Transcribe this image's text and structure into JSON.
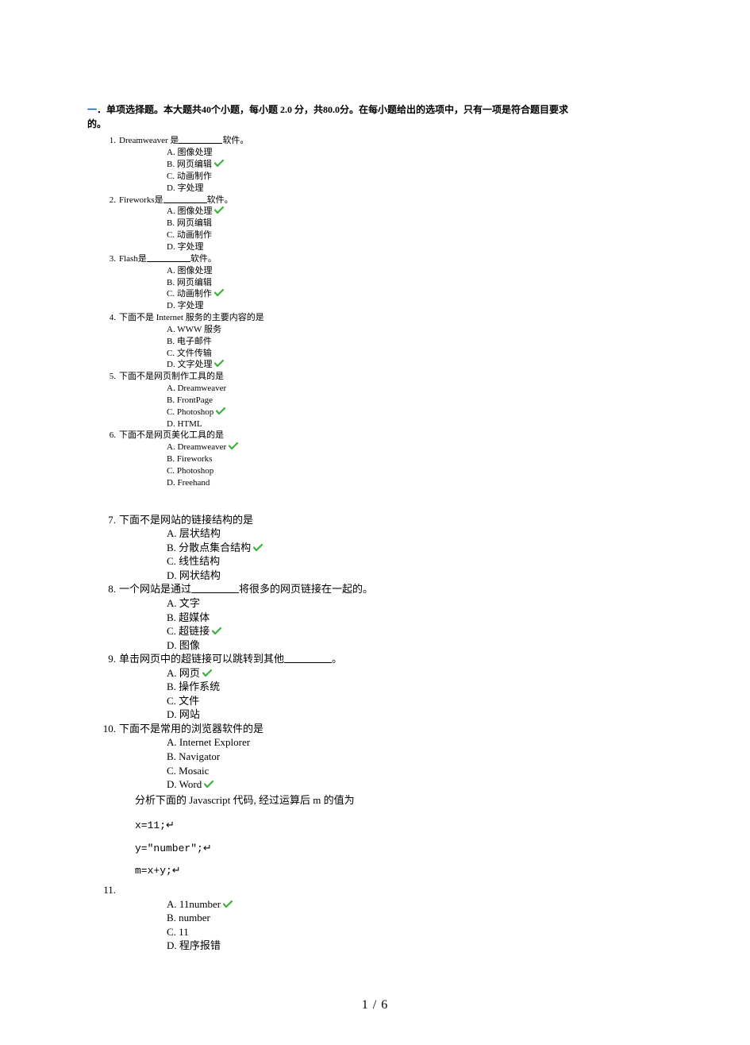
{
  "header": {
    "section_num": "一",
    "section_label": "．单项选择题。",
    "section_body_a": "本大题共40个小题，每小题 2.0 分，共80.0分。在每小题给出的选项中，只有一项是符合题目要求",
    "section_body_b": "的。"
  },
  "questions_small": [
    {
      "num": "1.",
      "stem_before": "Dreamweaver 是",
      "blank": true,
      "stem_after": "软件。",
      "options": [
        {
          "letter": "A.",
          "text": "图像处理",
          "correct": false
        },
        {
          "letter": "B.",
          "text": "网页编辑",
          "correct": true
        },
        {
          "letter": "C.",
          "text": "动画制作",
          "correct": false
        },
        {
          "letter": "D.",
          "text": "字处理",
          "correct": false
        }
      ]
    },
    {
      "num": "2.",
      "stem_before": "Fireworks是",
      "blank": true,
      "stem_after": "软件。",
      "options": [
        {
          "letter": "A.",
          "text": "图像处理",
          "correct": true
        },
        {
          "letter": "B.",
          "text": "网页编辑",
          "correct": false
        },
        {
          "letter": "C.",
          "text": "动画制作",
          "correct": false
        },
        {
          "letter": "D.",
          "text": "字处理",
          "correct": false
        }
      ]
    },
    {
      "num": "3.",
      "stem_before": "Flash是",
      "blank": true,
      "stem_after": "软件。",
      "options": [
        {
          "letter": "A.",
          "text": "图像处理",
          "correct": false
        },
        {
          "letter": "B.",
          "text": "网页编辑",
          "correct": false
        },
        {
          "letter": "C.",
          "text": "动画制作",
          "correct": true
        },
        {
          "letter": "D.",
          "text": "字处理",
          "correct": false
        }
      ]
    },
    {
      "num": "4.",
      "stem_before": "下面不是 Internet 服务的主要内容的是",
      "blank": false,
      "stem_after": "",
      "options": [
        {
          "letter": "A.",
          "text": "WWW 服务",
          "correct": false
        },
        {
          "letter": "B.",
          "text": "电子邮件",
          "correct": false
        },
        {
          "letter": "C.",
          "text": "文件传输",
          "correct": false
        },
        {
          "letter": "D.",
          "text": "文字处理",
          "correct": true
        }
      ]
    },
    {
      "num": "5.",
      "stem_before": "下面不是网页制作工具的是",
      "blank": false,
      "stem_after": "",
      "options": [
        {
          "letter": "A.",
          "text": "Dreamweaver",
          "correct": false
        },
        {
          "letter": "B.",
          "text": "FrontPage",
          "correct": false
        },
        {
          "letter": "C.",
          "text": "Photoshop",
          "correct": true
        },
        {
          "letter": "D.",
          "text": "HTML",
          "correct": false
        }
      ]
    },
    {
      "num": "6.",
      "stem_before": "下面不是网页美化工具的是",
      "blank": false,
      "stem_after": "",
      "options": [
        {
          "letter": "A.",
          "text": "Dreamweaver",
          "correct": true
        },
        {
          "letter": "B.",
          "text": "Fireworks",
          "correct": false
        },
        {
          "letter": "C.",
          "text": "Photoshop",
          "correct": false
        },
        {
          "letter": "D.",
          "text": "Freehand",
          "correct": false
        }
      ]
    }
  ],
  "questions_large": [
    {
      "num": "7.",
      "stem_before": "下面不是网站的链接结构的是",
      "blank": false,
      "stem_after": "",
      "options": [
        {
          "letter": "A.",
          "text": "层状结构",
          "correct": false
        },
        {
          "letter": "B.",
          "text": "分散点集合结构",
          "correct": true
        },
        {
          "letter": "C.",
          "text": "线性结构",
          "correct": false
        },
        {
          "letter": "D.",
          "text": "网状结构",
          "correct": false
        }
      ]
    },
    {
      "num": "8.",
      "stem_before": "一个网站是通过",
      "blank": true,
      "stem_after": "将很多的网页链接在一起的。",
      "options": [
        {
          "letter": "A.",
          "text": "文字",
          "correct": false
        },
        {
          "letter": "B.",
          "text": "超媒体",
          "correct": false
        },
        {
          "letter": "C.",
          "text": "超链接",
          "correct": true
        },
        {
          "letter": "D.",
          "text": "图像",
          "correct": false
        }
      ]
    },
    {
      "num": "9.",
      "stem_before": "单击网页中的超链接可以跳转到其他",
      "blank": true,
      "stem_after": "。",
      "options": [
        {
          "letter": "A.",
          "text": "网页",
          "correct": true
        },
        {
          "letter": "B.",
          "text": "操作系统",
          "correct": false
        },
        {
          "letter": "C.",
          "text": "文件",
          "correct": false
        },
        {
          "letter": "D.",
          "text": "网站",
          "correct": false
        }
      ]
    },
    {
      "num": "10.",
      "stem_before": "下面不是常用的浏览器软件的是",
      "blank": false,
      "stem_after": "",
      "options": [
        {
          "letter": "A.",
          "text": "Internet Explorer",
          "correct": false
        },
        {
          "letter": "B.",
          "text": "Navigator",
          "correct": false
        },
        {
          "letter": "C.",
          "text": "Mosaic",
          "correct": false
        },
        {
          "letter": "D.",
          "text": "Word",
          "correct": true
        }
      ]
    }
  ],
  "q11": {
    "num": "11.",
    "intro": "分析下面的 Javascript 代码, 经过运算后 m 的值为",
    "code": [
      "x=11;↵",
      "y=\"number\";↵",
      "m=x+y;↵"
    ],
    "options": [
      {
        "letter": "A.",
        "text": "11number",
        "correct": true
      },
      {
        "letter": "B.",
        "text": "number",
        "correct": false
      },
      {
        "letter": "C.",
        "text": "11",
        "correct": false
      },
      {
        "letter": "D.",
        "text": "程序报错",
        "correct": false
      }
    ]
  },
  "footer": {
    "page_current": "1",
    "page_sep": " / ",
    "page_total": "6"
  }
}
